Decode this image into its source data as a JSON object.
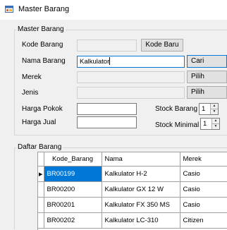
{
  "window": {
    "title": "Master Barang"
  },
  "master_group": {
    "legend": "Master Barang",
    "kode_barang": {
      "label": "Kode Barang",
      "value": ""
    },
    "kode_baru_button": "Kode Baru",
    "nama_barang": {
      "label": "Nama Barang",
      "value": "Kalkulator"
    },
    "cari_button": "Cari",
    "merek": {
      "label": "Merek",
      "value": ""
    },
    "merek_pilih_button": "Pilih",
    "jenis": {
      "label": "Jenis",
      "value": ""
    },
    "jenis_pilih_button": "Pilih",
    "harga_pokok": {
      "label": "Harga Pokok",
      "value": ""
    },
    "harga_jual": {
      "label": "Harga Jual",
      "value": ""
    },
    "stock_barang": {
      "label": "Stock Barang",
      "value": "1"
    },
    "stock_minimal": {
      "label": "Stock Minimal",
      "value": "1"
    }
  },
  "daftar_group": {
    "legend": "Daftar Barang",
    "columns": [
      "Kode_Barang",
      "Nama",
      "Merek"
    ],
    "rows": [
      {
        "kode": "BR00199",
        "nama": "Kalkulator H-2",
        "merek": "Casio"
      },
      {
        "kode": "BR00200",
        "nama": "Kalkulator GX 12 W",
        "merek": "Casio"
      },
      {
        "kode": "BR00201",
        "nama": "Kalkulator FX 350 MS",
        "merek": "Casio"
      },
      {
        "kode": "BR00202",
        "nama": "Kalkulator LC-310",
        "merek": "Citizen"
      }
    ],
    "selected_row": 0
  }
}
